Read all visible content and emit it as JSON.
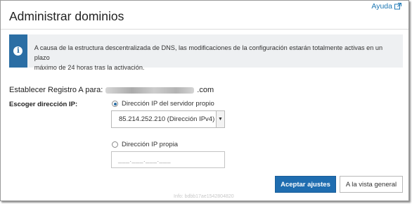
{
  "help": {
    "label": "Ayuda"
  },
  "page": {
    "title": "Administrar dominios"
  },
  "notice": {
    "line1": "A causa de la estructura descentralizada de DNS, las modificaciones de la configuración estarán totalmente activas en un plazo",
    "line2": "máximo de 24 horas tras la activación."
  },
  "record": {
    "prefix": "Establecer Registro A para:",
    "suffix": ".com"
  },
  "form": {
    "choose_label": "Escoger dirección IP:",
    "option_server": "Dirección IP del servidor propio",
    "option_server_selected": true,
    "server_ip_value": "85.214.252.210 (Dirección IPv4)",
    "option_own": "Dirección IP propia",
    "option_own_selected": false,
    "own_ip_placeholder": "___.___.___.___"
  },
  "buttons": {
    "accept": "Aceptar ajustes",
    "overview": "A la vista general"
  },
  "footer": {
    "info": "Info: bdbb17ae1542804820"
  },
  "colors": {
    "accent": "#1f6db0",
    "notice_bar": "#2b6ea4",
    "notice_bg": "#eef0f2"
  }
}
